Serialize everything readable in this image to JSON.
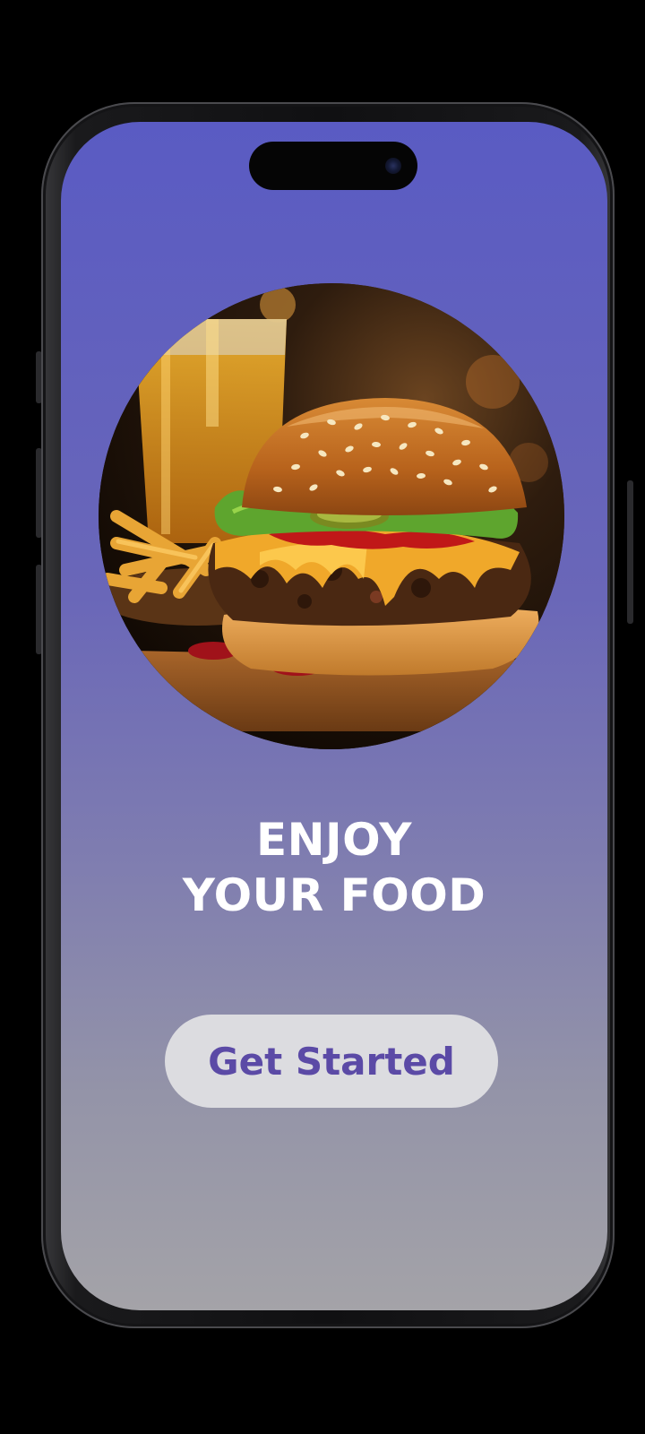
{
  "headline": {
    "line1": "ENJOY",
    "line2": "YOUR FOOD"
  },
  "cta": {
    "label": "Get Started"
  },
  "hero_image": {
    "subject": "cheeseburger with fries and drink"
  },
  "colors": {
    "screen_top": "#5a5bc3",
    "screen_bottom": "#a4a3a8",
    "button_bg": "#dcdce0",
    "button_text": "#5b4aa6",
    "headline_text": "#ffffff"
  }
}
